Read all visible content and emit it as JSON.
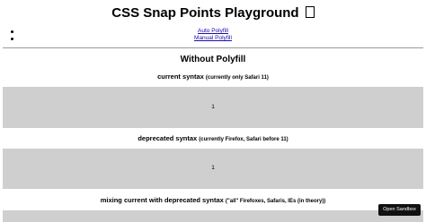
{
  "page": {
    "title": "CSS Snap Points Playground",
    "title_glyph": "missing-glyph-box"
  },
  "nav": {
    "links": [
      {
        "label": "Auto Polyfill"
      },
      {
        "label": "Manual Polyfill"
      }
    ]
  },
  "section": {
    "title": "Without Polyfill"
  },
  "demos": [
    {
      "heading": "current syntax",
      "note": "(currently only Safari 11)",
      "slide_label": "1"
    },
    {
      "heading": "deprecated syntax",
      "note": "(currently Firefox, Safari before 11)",
      "slide_label": "1"
    },
    {
      "heading": "mixing current with deprecated syntax",
      "note": "(\"all\" Firefoxes, Safaris, IEs (in theory))",
      "slide_label": ""
    }
  ],
  "sandbox_button": {
    "label": "Open Sandbox"
  },
  "colors": {
    "link": "#1a0dab",
    "scroller_background": "#cfcfcf",
    "button_background": "#111111",
    "button_text": "#ffffff",
    "divider": "#9a9a9a"
  }
}
